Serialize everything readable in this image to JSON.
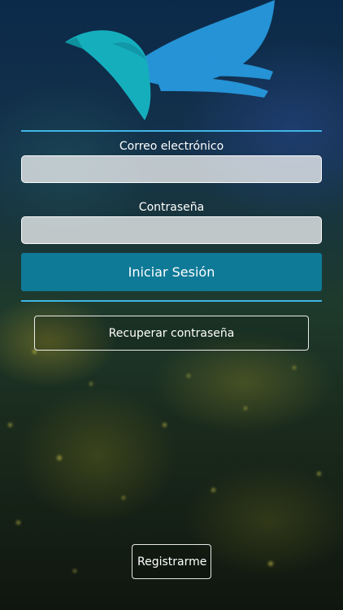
{
  "login": {
    "email_label": "Correo electrónico",
    "email_value": "",
    "password_label": "Contraseña",
    "password_value": "",
    "submit_label": "Iniciar Sesión",
    "recover_label": "Recuperar contraseña",
    "register_label": "Registrarme"
  },
  "icons": {
    "logo": "bird-logo-icon"
  },
  "colors": {
    "accent_line": "#3fb6e6",
    "primary_button": "#0f7a97",
    "logo_teal": "#15aebd",
    "logo_blue": "#2593d6"
  }
}
